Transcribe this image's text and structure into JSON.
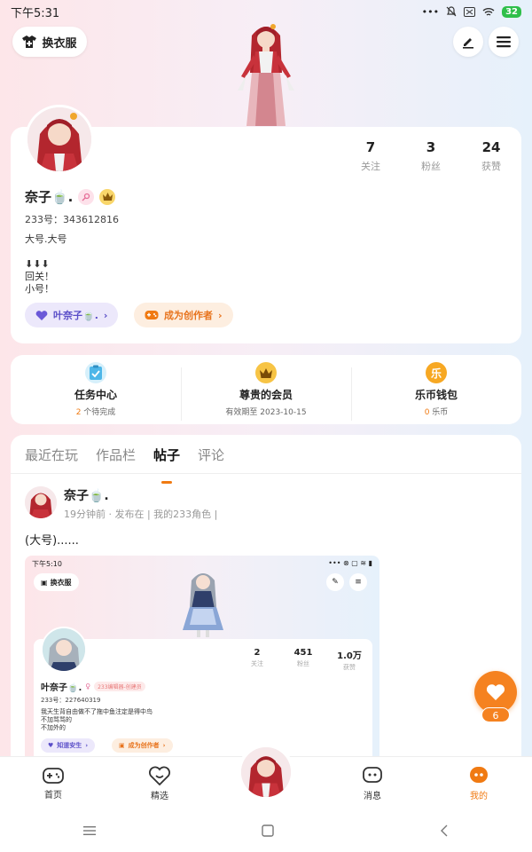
{
  "status_bar": {
    "time": "下午5:31",
    "dots": "•••",
    "battery": "32"
  },
  "top": {
    "wardrobe_label": "换衣服"
  },
  "profile": {
    "name": "奈子🍵.",
    "uid_line": "233号：343612816",
    "bio_lines": [
      "大号.大号",
      "",
      "⬇⬇⬇",
      "回关！",
      "小号！"
    ],
    "stats": [
      {
        "value": "7",
        "label": "关注"
      },
      {
        "value": "3",
        "label": "粉丝"
      },
      {
        "value": "24",
        "label": "获赞"
      }
    ],
    "friend_pill": "叶奈子🍵.",
    "creator_pill": "成为创作者"
  },
  "quick": [
    {
      "title": "任务中心",
      "count": "2",
      "sub": "个待完成",
      "icon": "task-icon"
    },
    {
      "title": "尊贵的会员",
      "sub_full": "有效期至 2023-10-15",
      "icon": "crown-icon"
    },
    {
      "title": "乐币钱包",
      "count": "0",
      "sub": "乐币",
      "icon": "coin-icon",
      "coin_glyph": "乐"
    }
  ],
  "tabs": [
    "最近在玩",
    "作品栏",
    "帖子",
    "评论"
  ],
  "active_tab": "帖子",
  "post": {
    "author": "奈子🍵.",
    "meta": "19分钟前 · 发布在 | 我的233角色 |",
    "text": "(大号)......",
    "likes": "6"
  },
  "post_image": {
    "time": "下午5:10",
    "wardrobe_label": "换衣服",
    "stats": [
      {
        "value": "2",
        "label": "关注"
      },
      {
        "value": "451",
        "label": "粉丝"
      },
      {
        "value": "1.0万",
        "label": "获赞"
      }
    ],
    "name": "叶奈子🍵.",
    "tag": "233编辑器-创建员",
    "uid_line": "233号：227640319",
    "bio_lines": [
      "我天生背自由做不了拖中鱼注定是得中鸟",
      "不加骂骂的",
      "不加外的"
    ],
    "pill1": "知道安生",
    "pill2": "成为创作者"
  },
  "nav": [
    {
      "label": "首页",
      "icon": "gamepad-icon"
    },
    {
      "label": "精选",
      "icon": "heart-chat-icon"
    },
    {
      "label": "",
      "icon": "avatar"
    },
    {
      "label": "消息",
      "icon": "message-icon"
    },
    {
      "label": "我的",
      "icon": "me-icon"
    }
  ],
  "colors": {
    "accent": "#f07a12",
    "friend_pill_bg": "#ece8fb",
    "creator_pill_bg": "#fdeee0"
  }
}
